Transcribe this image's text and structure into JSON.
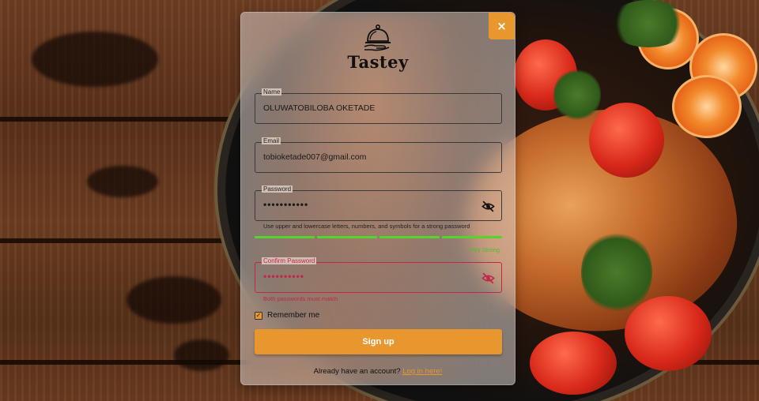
{
  "brand": {
    "name": "Tastey",
    "logo_icon": "cloche-icon"
  },
  "modal": {
    "close_label": "×"
  },
  "form": {
    "name": {
      "label": "Name",
      "value": "OLUWATOBILOBA OKETADE"
    },
    "email": {
      "label": "Email",
      "value": "tobioketade007@gmail.com"
    },
    "password": {
      "label": "Password",
      "value": "•••••••••••",
      "hint": "Use upper and lowercase letters, numbers, and symbols for a strong password",
      "strength_text": "Very Strong",
      "strength_level": 1.0,
      "visibility_icon": "eye-off-icon"
    },
    "confirm_password": {
      "label": "Confirm Password",
      "value": "••••••••••",
      "error": "Both passwords must match",
      "visibility_icon": "eye-off-icon"
    },
    "remember_me": {
      "label": "Remember me",
      "checked": true
    },
    "submit_label": "Sign up",
    "footer_text": "Already have an account? ",
    "login_link": "Log in here!"
  },
  "colors": {
    "accent": "#e8962e",
    "error": "#c2264a",
    "strength": "#52d62b"
  }
}
